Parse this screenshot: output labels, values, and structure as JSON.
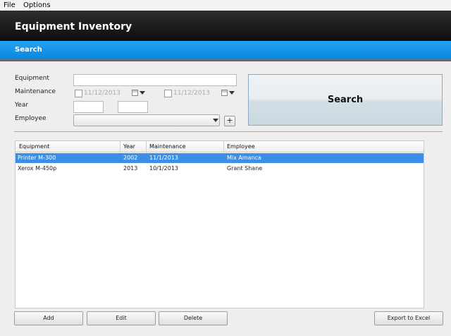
{
  "menu": {
    "file": "File",
    "options": "Options"
  },
  "header": {
    "title": "Equipment Inventory"
  },
  "section": {
    "title": "Search"
  },
  "form": {
    "equipment_label": "Equipment",
    "equipment_value": "",
    "maintenance_label": "Maintenance",
    "maintenance_from": "11/12/2013",
    "maintenance_to": "11/12/2013",
    "year_label": "Year",
    "year_from": "",
    "year_to": "",
    "employee_label": "Employee",
    "employee_value": "",
    "add_employee": "+"
  },
  "search_button": "Search",
  "table": {
    "columns": [
      "Equipment",
      "Year",
      "Maintenance",
      "Employee"
    ],
    "rows": [
      {
        "equipment": "Printer M-300",
        "year": "2002",
        "maintenance": "11/1/2013",
        "employee": "Mix Amanca"
      },
      {
        "equipment": "Xerox M-450p",
        "year": "2013",
        "maintenance": "10/1/2013",
        "employee": "Grant Shane"
      }
    ],
    "selected_row": 0
  },
  "buttons": {
    "add": "Add",
    "edit": "Edit",
    "delete": "Delete",
    "export": "Export to Excel"
  },
  "colors": {
    "header_bg": "#1a1a1a",
    "accent_blue": "#1396ec",
    "selection": "#3d8ee6"
  },
  "icons": [
    "calendar-icon",
    "chevron-down-icon",
    "plus-icon"
  ]
}
